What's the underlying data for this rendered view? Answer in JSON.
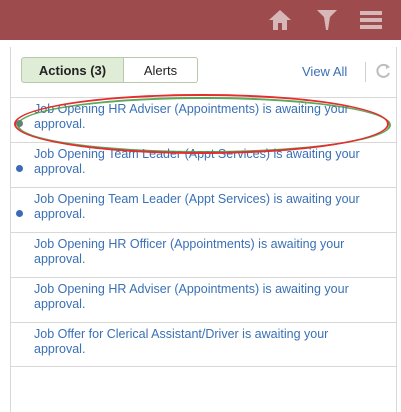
{
  "header": {
    "icons": [
      "home-icon",
      "flag-icon",
      "menu-icon"
    ],
    "bar_color": "#9e4b4e"
  },
  "tabs": [
    {
      "label": "Actions (3)",
      "active": true
    },
    {
      "label": "Alerts",
      "active": false
    }
  ],
  "toolbar": {
    "view_all": "View All",
    "refresh_icon": "refresh-icon"
  },
  "items": [
    {
      "text": "Job Opening HR Adviser (Appointments) is awaiting your approval.",
      "unread": true
    },
    {
      "text": "Job Opening Team Leader (Appt Services) is awaiting your approval.",
      "unread": true
    },
    {
      "text": "Job Opening Team Leader (Appt Services) is awaiting your approval.",
      "unread": true
    },
    {
      "text": "Job Opening HR Officer (Appointments) is awaiting your approval.",
      "unread": false
    },
    {
      "text": "Job Opening HR Adviser (Appointments) is awaiting your approval.",
      "unread": false
    },
    {
      "text": "Job Offer for Clerical Assistant/Driver is awaiting your approval.",
      "unread": false
    }
  ],
  "annotation_colors": {
    "red_oval": "#e62c2c",
    "green_oval": "#3f9a3f"
  }
}
